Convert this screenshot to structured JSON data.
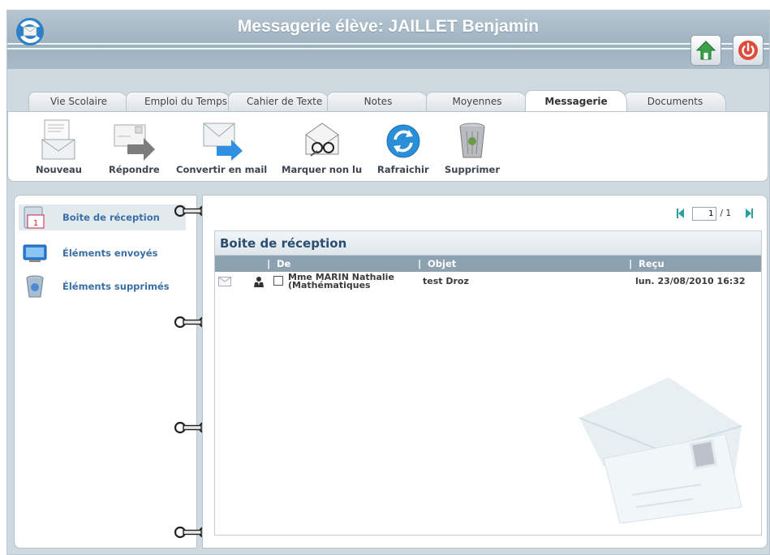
{
  "header": {
    "title": "Messagerie élève: JAILLET Benjamin"
  },
  "tabs": [
    {
      "label": "Vie Scolaire",
      "active": false
    },
    {
      "label": "Emploi du Temps",
      "active": false
    },
    {
      "label": "Cahier de Texte",
      "active": false
    },
    {
      "label": "Notes",
      "active": false
    },
    {
      "label": "Moyennes",
      "active": false
    },
    {
      "label": "Messagerie",
      "active": true
    },
    {
      "label": "Documents",
      "active": false
    }
  ],
  "toolbar": {
    "new_label": "Nouveau",
    "reply_label": "Répondre",
    "convert_label": "Convertir en mail",
    "mark_unread_label": "Marquer non lu",
    "refresh_label": "Rafraichir",
    "delete_label": "Supprimer"
  },
  "folders": [
    {
      "label": "Boite de réception",
      "icon": "inbox-icon",
      "active": true
    },
    {
      "label": "Éléments envoyés",
      "icon": "sent-icon",
      "active": false
    },
    {
      "label": "Éléments supprimés",
      "icon": "trash-icon",
      "active": false
    }
  ],
  "pager": {
    "current": "1",
    "total": "/ 1"
  },
  "list": {
    "title": "Boite de réception",
    "columns": {
      "from": "De",
      "subject": "Objet",
      "received": "Reçu"
    },
    "rows": [
      {
        "from": "Mme MARIN Nathalie (Mathématiques",
        "subject": "test Droz",
        "received": "lun. 23/08/2010 16:32"
      }
    ]
  },
  "colors": {
    "accent": "#3a6fa6",
    "header_bg": "#a9bac7",
    "column_bar": "#8da2b1"
  }
}
